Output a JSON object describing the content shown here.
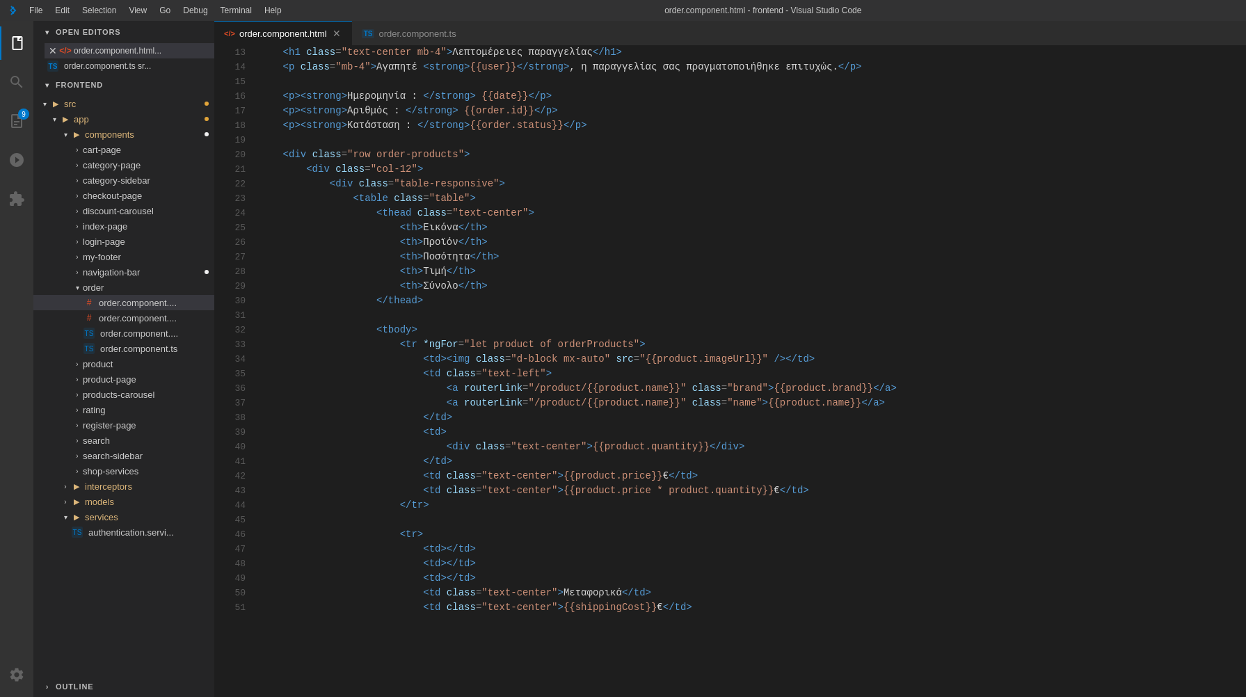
{
  "titlebar": {
    "title": "order.component.html - frontend - Visual Studio Code",
    "menus": [
      "File",
      "Edit",
      "Selection",
      "View",
      "Go",
      "Debug",
      "Terminal",
      "Help"
    ]
  },
  "activitybar": {
    "items": [
      {
        "name": "explorer",
        "label": "Explorer",
        "active": true
      },
      {
        "name": "search",
        "label": "Search",
        "active": false
      },
      {
        "name": "source-control",
        "label": "Source Control",
        "badge": "9"
      },
      {
        "name": "debug",
        "label": "Run and Debug",
        "active": false
      },
      {
        "name": "extensions",
        "label": "Extensions",
        "active": false
      }
    ],
    "bottom": [
      {
        "name": "settings",
        "label": "Settings"
      }
    ]
  },
  "sidebar": {
    "open_editors_header": "OPEN EDITORS",
    "open_editors": [
      {
        "type": "html",
        "name": "order.component.html",
        "modified": true
      },
      {
        "type": "ts",
        "name": "order.component.ts sr..."
      }
    ],
    "frontend_header": "FRONTEND",
    "tree": {
      "src": {
        "expanded": true,
        "app": {
          "expanded": true,
          "components": {
            "expanded": true,
            "modified": true,
            "items": [
              "cart-page",
              "category-page",
              "category-sidebar",
              "checkout-page",
              "discount-carousel",
              "index-page",
              "login-page",
              "my-footer",
              "navigation-bar",
              "order",
              "product",
              "product-page",
              "products-carousel",
              "rating",
              "register-page",
              "search",
              "search-sidebar",
              "shop-services"
            ]
          },
          "interceptors": "interceptors",
          "models": "models",
          "services": {
            "expanded": true,
            "items": [
              "authentication.servi..."
            ]
          }
        }
      }
    }
  },
  "tabs": [
    {
      "id": "tab1",
      "label": "order.component.html",
      "type": "html",
      "active": true,
      "modified": true
    },
    {
      "id": "tab2",
      "label": "order.component.ts",
      "type": "ts",
      "active": false,
      "modified": false
    }
  ],
  "code": {
    "lines": [
      {
        "num": 13,
        "content": "    <h1 class=\"text-center mb-4\">Λεπτομέρειες παραγγελίας</h1>"
      },
      {
        "num": 14,
        "content": "    <p class=\"mb-4\">Αγαπητέ <strong>{{user}}</strong>, η παραγγελίας σας πραγματοποιήθηκε επιτυχώς.</p>"
      },
      {
        "num": 15,
        "content": ""
      },
      {
        "num": 16,
        "content": "    <p><strong>Ημερομηνία : </strong> {{date}}</p>"
      },
      {
        "num": 17,
        "content": "    <p><strong>Αριθμός : </strong> {{order.id}}</p>"
      },
      {
        "num": 18,
        "content": "    <p><strong>Κατάσταση : </strong>{{order.status}}</p>"
      },
      {
        "num": 19,
        "content": ""
      },
      {
        "num": 20,
        "content": "    <div class=\"row order-products\">"
      },
      {
        "num": 21,
        "content": "        <div class=\"col-12\">"
      },
      {
        "num": 22,
        "content": "            <div class=\"table-responsive\">"
      },
      {
        "num": 23,
        "content": "                <table class=\"table\">"
      },
      {
        "num": 24,
        "content": "                    <thead class=\"text-center\">"
      },
      {
        "num": 25,
        "content": "                        <th>Εικόνα</th>"
      },
      {
        "num": 26,
        "content": "                        <th>Προϊόν</th>"
      },
      {
        "num": 27,
        "content": "                        <th>Ποσότητα</th>"
      },
      {
        "num": 28,
        "content": "                        <th>Τιμή</th>"
      },
      {
        "num": 29,
        "content": "                        <th>Σύνολο</th>"
      },
      {
        "num": 30,
        "content": "                    </thead>"
      },
      {
        "num": 31,
        "content": ""
      },
      {
        "num": 32,
        "content": "                    <tbody>"
      },
      {
        "num": 33,
        "content": "                        <tr *ngFor=\"let product of orderProducts\">"
      },
      {
        "num": 34,
        "content": "                            <td><img class=\"d-block mx-auto\" src=\"{{product.imageUrl}}\" /></td>"
      },
      {
        "num": 35,
        "content": "                            <td class=\"text-left\">"
      },
      {
        "num": 36,
        "content": "                                <a routerLink=\"/product/{{product.name}}\" class=\"brand\">{{product.brand}}</a>"
      },
      {
        "num": 37,
        "content": "                                <a routerLink=\"/product/{{product.name}}\" class=\"name\">{{product.name}}</a>"
      },
      {
        "num": 38,
        "content": "                            </td>"
      },
      {
        "num": 39,
        "content": "                            <td>"
      },
      {
        "num": 40,
        "content": "                                <div class=\"text-center\">{{product.quantity}}</div>"
      },
      {
        "num": 41,
        "content": "                            </td>"
      },
      {
        "num": 42,
        "content": "                            <td class=\"text-center\">{{product.price}}€</td>"
      },
      {
        "num": 43,
        "content": "                            <td class=\"text-center\">{{product.price * product.quantity}}€</td>"
      },
      {
        "num": 44,
        "content": "                        </tr>"
      },
      {
        "num": 45,
        "content": ""
      },
      {
        "num": 46,
        "content": "                        <tr>"
      },
      {
        "num": 47,
        "content": "                            <td></td>"
      },
      {
        "num": 48,
        "content": "                            <td></td>"
      },
      {
        "num": 49,
        "content": "                            <td></td>"
      },
      {
        "num": 50,
        "content": "                            <td class=\"text-center\">Μεταφορικά</td>"
      },
      {
        "num": 51,
        "content": "                            <td class=\"text-center\">{{shippingCost}}€</td>"
      }
    ]
  },
  "outline": {
    "label": "OUTLINE"
  }
}
